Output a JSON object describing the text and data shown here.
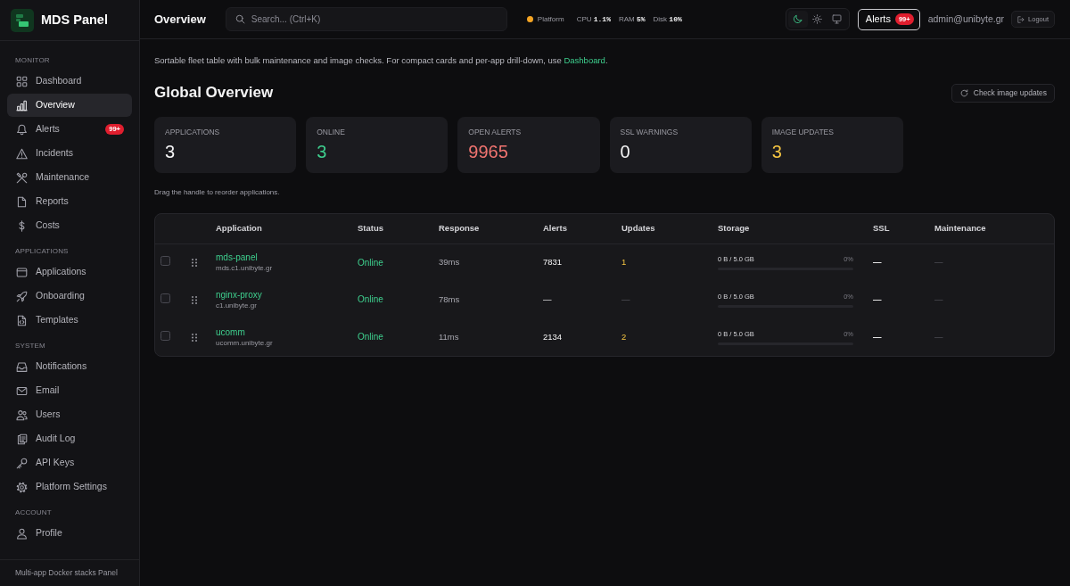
{
  "sidebar": {
    "brand": "MDS Panel",
    "sections": [
      {
        "title": "MONITOR",
        "items": [
          {
            "label": "Dashboard",
            "selected": false
          },
          {
            "label": "Overview",
            "selected": true
          },
          {
            "label": "Alerts",
            "selected": false,
            "badge": "99+"
          },
          {
            "label": "Incidents",
            "selected": false
          },
          {
            "label": "Maintenance",
            "selected": false
          },
          {
            "label": "Reports",
            "selected": false
          },
          {
            "label": "Costs",
            "selected": false
          }
        ]
      },
      {
        "title": "APPLICATIONS",
        "items": [
          {
            "label": "Applications",
            "selected": false
          },
          {
            "label": "Onboarding",
            "selected": false
          },
          {
            "label": "Templates",
            "selected": false
          }
        ]
      },
      {
        "title": "SYSTEM",
        "items": [
          {
            "label": "Notifications",
            "selected": false
          },
          {
            "label": "Email",
            "selected": false
          },
          {
            "label": "Users",
            "selected": false
          },
          {
            "label": "Audit Log",
            "selected": false
          },
          {
            "label": "API Keys",
            "selected": false
          },
          {
            "label": "Platform Settings",
            "selected": false
          }
        ]
      },
      {
        "title": "ACCOUNT",
        "items": [
          {
            "label": "Profile",
            "selected": false
          }
        ]
      }
    ],
    "footer": "Multi-app Docker stacks Panel"
  },
  "topbar": {
    "title": "Overview",
    "search": {
      "placeholder": "Search... (Ctrl+K)"
    },
    "platform": {
      "label": "Platform",
      "healthy": false
    },
    "metrics": [
      {
        "label": "CPU",
        "value": "1.1%"
      },
      {
        "label": "RAM",
        "value": "5%"
      },
      {
        "label": "Disk",
        "value": "10%"
      }
    ],
    "theme_modes": [
      {
        "selected": true
      },
      {
        "selected": false
      },
      {
        "selected": false
      }
    ],
    "alerts": {
      "label": "Alerts",
      "badge": "99+"
    },
    "user": "admin@unibyte.gr",
    "logout": "Logout"
  },
  "intro": {
    "text": "Sortable fleet table with bulk maintenance and image checks. For compact cards and per-app drill-down, use ",
    "link": "Dashboard",
    "end": "."
  },
  "heading": "Global Overview",
  "check_button": "Check image updates",
  "stats": [
    {
      "label": "APPLICATIONS",
      "value": "3",
      "color": "#f4f4f5"
    },
    {
      "label": "ONLINE",
      "value": "3",
      "color": "#3ecf8e"
    },
    {
      "label": "OPEN ALERTS",
      "value": "9965",
      "color": "#f07470"
    },
    {
      "label": "SSL WARNINGS",
      "value": "0",
      "color": "#f4f4f5"
    },
    {
      "label": "IMAGE UPDATES",
      "value": "3",
      "color": "#f5c542"
    }
  ],
  "hint": "Drag the handle to reorder applications.",
  "table": {
    "columns": [
      "Application",
      "Status",
      "Response",
      "Alerts",
      "Updates",
      "Storage",
      "SSL",
      "Maintenance"
    ],
    "rows": [
      {
        "checked": false,
        "name": "mds-panel",
        "host": "mds.c1.unibyte.gr",
        "status": "Online",
        "response": "39ms",
        "alerts": "7831",
        "updates": "1",
        "update_available": true,
        "storage": "0 B / 5.0 GB",
        "storage_percent": "0%",
        "level": 0,
        "ssl": "—",
        "maintenance": "—"
      },
      {
        "checked": false,
        "name": "nginx-proxy",
        "host": "c1.unibyte.gr",
        "status": "Online",
        "response": "78ms",
        "alerts": "—",
        "updates": "—",
        "update_available": false,
        "storage": "0 B / 5.0 GB",
        "storage_percent": "0%",
        "level": 0,
        "ssl": "—",
        "maintenance": "—"
      },
      {
        "checked": false,
        "name": "ucomm",
        "host": "ucomm.unibyte.gr",
        "status": "Online",
        "response": "11ms",
        "alerts": "2134",
        "updates": "2",
        "update_available": true,
        "storage": "0 B / 5.0 GB",
        "storage_percent": "0%",
        "level": 0,
        "ssl": "—",
        "maintenance": "—"
      }
    ]
  }
}
